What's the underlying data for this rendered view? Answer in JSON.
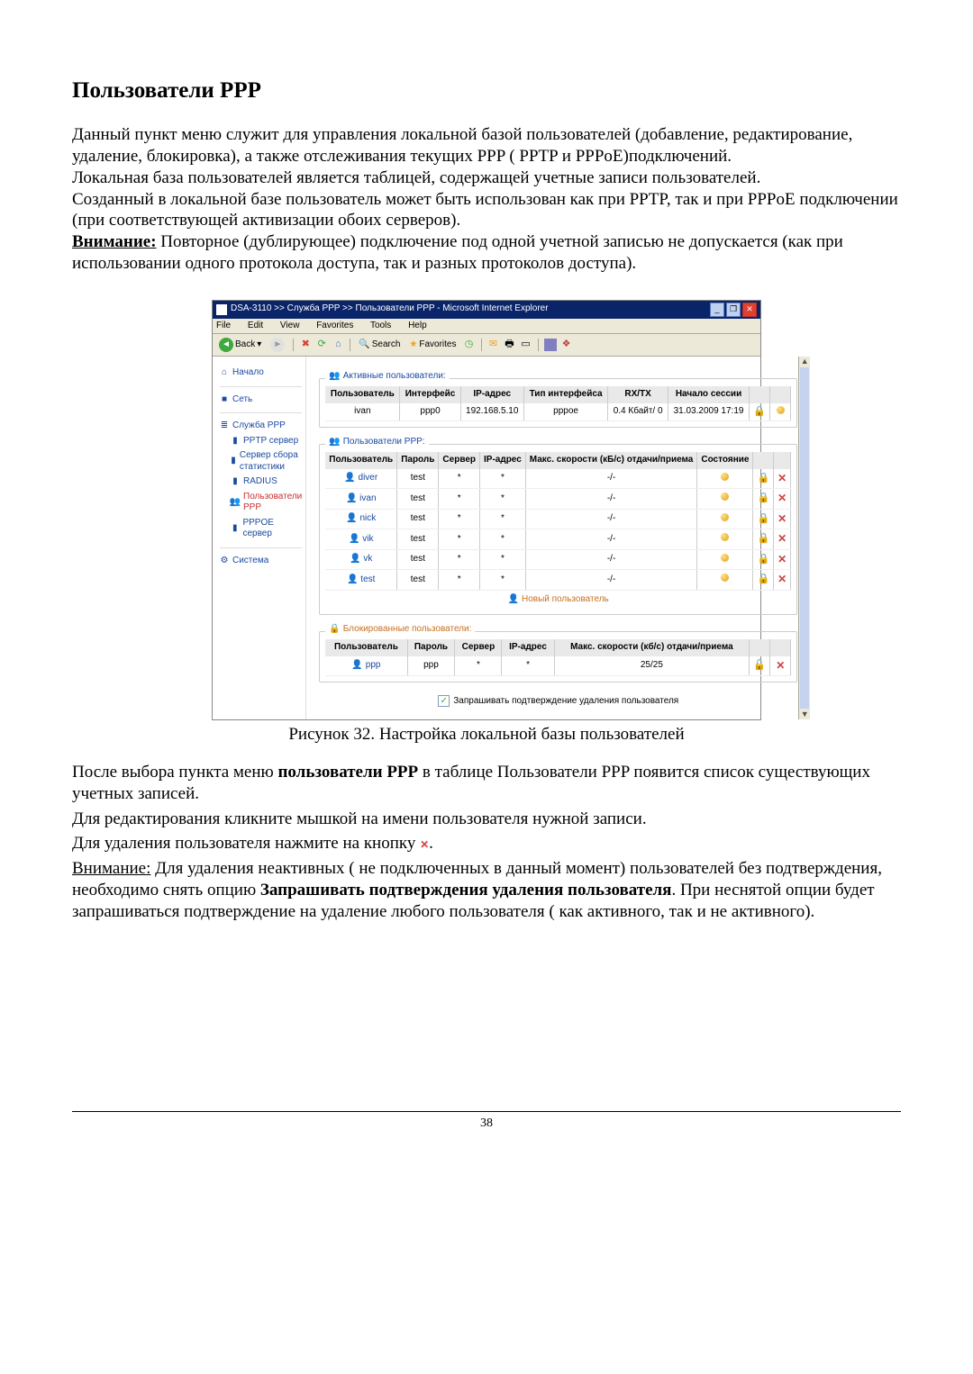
{
  "doc": {
    "title": "Пользователи PPP",
    "para1": "Данный пункт меню служит для управления локальной базой пользователей (добавление, редактирование, удаление, блокировка), а также отслеживания текущих PPP ( PPTP и PPPoE)подключений.",
    "para2": "Локальная база пользователей является таблицей, содержащей учетные записи пользователей.",
    "para3": "Созданный в локальной базе пользователь может быть использован как при PPTP, так и при PPPoE подключении (при соответствующей активизации обоих серверов).",
    "warn_label": "Внимание:",
    "warn_text": " Повторное (дублирующее) подключение под одной учетной записью не допускается (как при использовании одного протокола доступа, так и разных протоколов доступа).",
    "fig_caption": "Рисунок 32. Настройка локальной базы пользователей",
    "after1_a": "    После выбора пункта меню ",
    "after1_b": "пользователи PPP",
    "after1_c": "  в таблице Пользователи PPP появится список существующих учетных записей.",
    "after2": "   Для редактирования  кликните мышкой на имени пользователя нужной записи.",
    "after3": "   Для удаления пользователя нажмите на кнопку ",
    "after3_dot": ".",
    "after4_u": "Внимание:",
    "after4_a": " Для удаления  неактивных ( не подключенных в данный момент) пользователей без подтверждения, необходимо снять опцию ",
    "after4_b": "Запрашивать подтверждения удаления пользователя",
    "after4_c": ". При неснятой опции будет запрашиваться подтверждение на удаление любого пользователя ( как активного, так и не активного).",
    "page_number": "38"
  },
  "ie": {
    "title": "DSA-3110 >> Служба PPP >> Пользователи PPP - Microsoft Internet Explorer",
    "menus": [
      "File",
      "Edit",
      "View",
      "Favorites",
      "Tools",
      "Help"
    ],
    "back": "Back",
    "search": "Search",
    "favorites": "Favorites"
  },
  "nav": {
    "home": "Начало",
    "net": "Сеть",
    "ppp": "Служба PPP",
    "pptp": "PPTP сервер",
    "stats": "Сервер сбора статистики",
    "radius": "RADIUS",
    "users": "Пользователи PPP",
    "pppoe": "PPPOE сервер",
    "system": "Система"
  },
  "active": {
    "legend": "Активные пользователи:",
    "cols": [
      "Пользователь",
      "Интерфейс",
      "IP-адрес",
      "Тип интерфейса",
      "RX/TX",
      "Начало сессии"
    ],
    "row": {
      "user": "ivan",
      "iface": "ppp0",
      "ip": "192.168.5.10",
      "type": "pppoe",
      "rxtx": "0.4 Кбайт/ 0",
      "start": "31.03.2009 17:19"
    }
  },
  "users": {
    "legend": "Пользователи PPP:",
    "cols": [
      "Пользователь",
      "Пароль",
      "Сервер",
      "IP-адрес",
      "Макс. скорости (кБ/с) отдачи/приема",
      "Состояние"
    ],
    "rows": [
      {
        "user": "diver",
        "pass": "test",
        "srv": "*",
        "ip": "*",
        "spd": "-/-"
      },
      {
        "user": "ivan",
        "pass": "test",
        "srv": "*",
        "ip": "*",
        "spd": "-/-"
      },
      {
        "user": "nick",
        "pass": "test",
        "srv": "*",
        "ip": "*",
        "spd": "-/-"
      },
      {
        "user": "vik",
        "pass": "test",
        "srv": "*",
        "ip": "*",
        "spd": "-/-"
      },
      {
        "user": "vk",
        "pass": "test",
        "srv": "*",
        "ip": "*",
        "spd": "-/-"
      },
      {
        "user": "test",
        "pass": "test",
        "srv": "*",
        "ip": "*",
        "spd": "-/-"
      }
    ],
    "add": "Новый пользователь"
  },
  "blocked": {
    "legend": "Блокированные пользователи:",
    "cols": [
      "Пользователь",
      "Пароль",
      "Сервер",
      "IP-адрес",
      "Макс. скорости (кб/c) отдачи/приема"
    ],
    "row": {
      "user": "ppp",
      "pass": "ppp",
      "srv": "*",
      "ip": "*",
      "spd": "25/25"
    }
  },
  "confirm": "Запрашивать подтверждение удаления пользователя"
}
